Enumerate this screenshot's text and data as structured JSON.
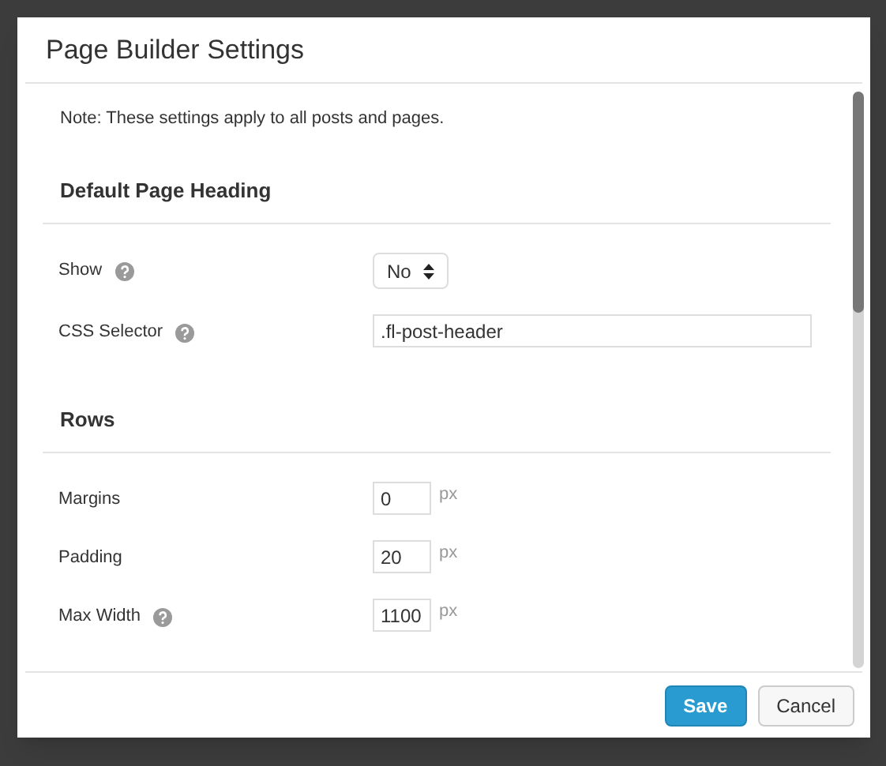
{
  "dialog": {
    "title": "Page Builder Settings",
    "note": "Note: These settings apply to all posts and pages.",
    "sections": [
      {
        "heading": "Default Page Heading",
        "fields": [
          {
            "label": "Show",
            "help": true,
            "kind": "select",
            "value": "No"
          },
          {
            "label": "CSS Selector",
            "help": true,
            "kind": "text",
            "value": ".fl-post-header"
          }
        ]
      },
      {
        "heading": "Rows",
        "fields": [
          {
            "label": "Margins",
            "help": false,
            "kind": "number",
            "value": "0",
            "unit": "px"
          },
          {
            "label": "Padding",
            "help": false,
            "kind": "number",
            "value": "20",
            "unit": "px"
          },
          {
            "label": "Max Width",
            "help": true,
            "kind": "number",
            "value": "1100",
            "unit": "px"
          }
        ]
      }
    ],
    "buttons": [
      {
        "label": "Save",
        "kind": "primary"
      },
      {
        "label": "Cancel",
        "kind": "secondary"
      }
    ]
  }
}
